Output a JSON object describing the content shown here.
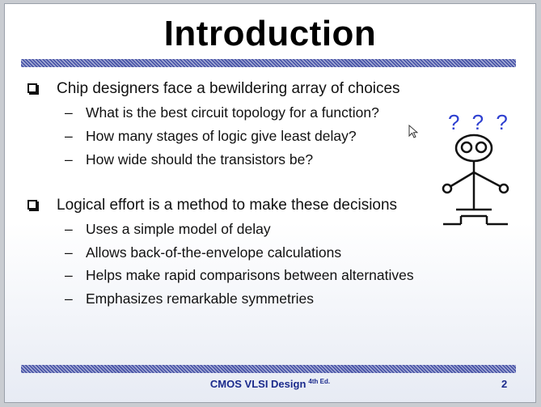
{
  "slide": {
    "title": "Introduction",
    "sections": [
      {
        "bullet": "Chip designers face a bewildering array of choices",
        "subitems": [
          "What is the best circuit topology for a function?",
          "How many stages of logic give least delay?",
          "How wide should the transistors be?"
        ]
      },
      {
        "bullet": "Logical effort is a method to make these decisions",
        "subitems": [
          "Uses a simple model of delay",
          "Allows back-of-the-envelope calculations",
          "Helps make rapid comparisons between alternatives",
          "Emphasizes remarkable symmetries"
        ]
      }
    ],
    "question_marks": "? ? ?",
    "figure_icon": "stick-figure-transistor-icon",
    "footer": {
      "course": "CMOS VLSI Design",
      "edition": "4th Ed.",
      "page": "2"
    }
  },
  "colors": {
    "band": "#4a56a8",
    "footer_text": "#1b2a8c",
    "question_marks": "#2d3fd0"
  },
  "cursor_icon": "mouse-pointer-icon"
}
